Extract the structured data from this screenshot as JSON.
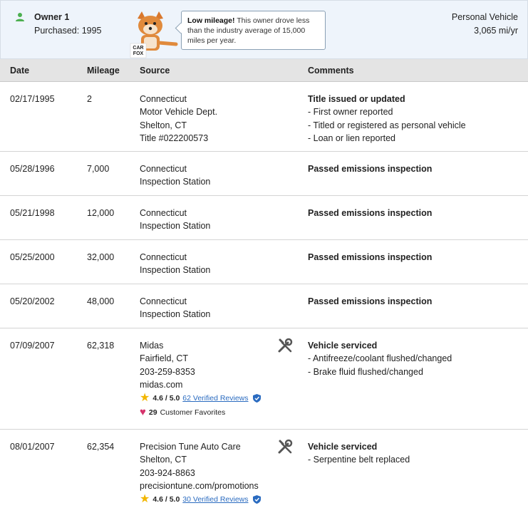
{
  "owner": {
    "title": "Owner 1",
    "purchased": "Purchased: 1995",
    "tooltip_bold": "Low mileage!",
    "tooltip_text": " This owner drove less than the industry average of 15,000 miles per year.",
    "vehicle_type": "Personal Vehicle",
    "rate": "3,065 mi/yr",
    "fox_text": "CAR FOX"
  },
  "headers": {
    "date": "Date",
    "mileage": "Mileage",
    "source": "Source",
    "comments": "Comments"
  },
  "rows": [
    {
      "date": "02/17/1995",
      "mileage": "2",
      "source": [
        "Connecticut",
        "Motor Vehicle Dept.",
        "Shelton, CT",
        "Title #022200573"
      ],
      "comment_head": "Title issued or updated",
      "comments": [
        "- First owner reported",
        "- Titled or registered as personal vehicle",
        "- Loan or lien reported"
      ]
    },
    {
      "date": "05/28/1996",
      "mileage": "7,000",
      "source": [
        "Connecticut",
        "Inspection Station"
      ],
      "comment_head": "Passed emissions inspection",
      "comments": []
    },
    {
      "date": "05/21/1998",
      "mileage": "12,000",
      "source": [
        "Connecticut",
        "Inspection Station"
      ],
      "comment_head": "Passed emissions inspection",
      "comments": []
    },
    {
      "date": "05/25/2000",
      "mileage": "32,000",
      "source": [
        "Connecticut",
        "Inspection Station"
      ],
      "comment_head": "Passed emissions inspection",
      "comments": []
    },
    {
      "date": "05/20/2002",
      "mileage": "48,000",
      "source": [
        "Connecticut",
        "Inspection Station"
      ],
      "comment_head": "Passed emissions inspection",
      "comments": []
    },
    {
      "date": "07/09/2007",
      "mileage": "62,318",
      "source": [
        "Midas",
        "Fairfield, CT",
        "203-259-8353",
        "midas.com"
      ],
      "comment_head": "Vehicle serviced",
      "comments": [
        "- Antifreeze/coolant flushed/changed",
        "- Brake fluid flushed/changed"
      ],
      "rating": "4.6 / 5.0",
      "reviews": "62 Verified Reviews",
      "favorites_count": "29",
      "favorites_label": "Customer Favorites"
    },
    {
      "date": "08/01/2007",
      "mileage": "62,354",
      "source": [
        "Precision Tune Auto Care",
        "Shelton, CT",
        "203-924-8863",
        "precisiontune.com/promotions"
      ],
      "comment_head": "Vehicle serviced",
      "comments": [
        "- Serpentine belt replaced"
      ],
      "rating": "4.6 / 5.0",
      "reviews": "30 Verified Reviews"
    }
  ],
  "icons": {
    "owner": "person-icon",
    "service": "wrench-screwdriver-icon",
    "star": "star-icon",
    "heart": "heart-icon",
    "verified": "shield-check-icon"
  },
  "colors": {
    "owner_bg": "#eef4fb",
    "header_bg": "#e4e4e4",
    "link": "#2a6bc0",
    "star": "#f2b600",
    "heart": "#d6336c",
    "owner_icon": "#4caf50"
  }
}
